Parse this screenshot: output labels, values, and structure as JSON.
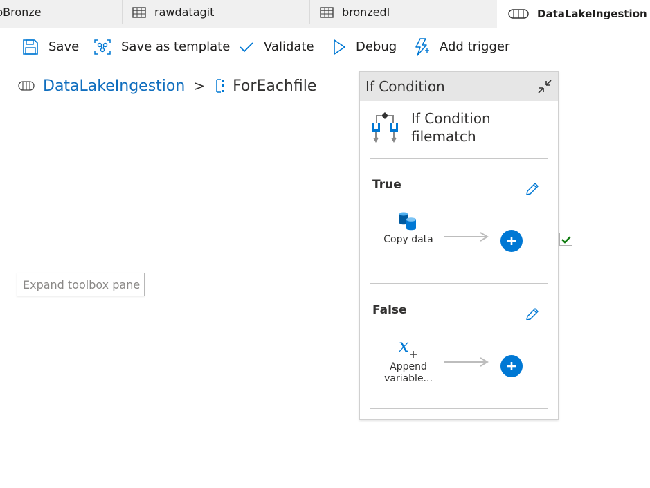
{
  "tabs": [
    {
      "label": "pBronze",
      "icon": "pipeline-icon"
    },
    {
      "label": "rawdatagit",
      "icon": "table-icon"
    },
    {
      "label": "bronzedl",
      "icon": "table-icon"
    },
    {
      "label": "DataLakeIngestion",
      "icon": "pipeline-icon",
      "active": true
    }
  ],
  "toolbar": {
    "save_label": "Save",
    "template_label": "Save as template",
    "validate_label": "Validate",
    "debug_label": "Debug",
    "trigger_label": "Add trigger"
  },
  "breadcrumb": {
    "pipeline": "DataLakeIngestion",
    "separator": ">",
    "current": "ForEachfile"
  },
  "expand_toolbox": "Expand toolbox pane",
  "if_condition": {
    "header": "If Condition",
    "activity_type": "If Condition",
    "activity_name": "filematch",
    "true_branch": {
      "label": "True",
      "activity_label": "Copy data"
    },
    "false_branch": {
      "label": "False",
      "activity_label_line1": "Append",
      "activity_label_line2": "variable..."
    }
  },
  "colors": {
    "accent": "#0078d4",
    "link": "#106ebe",
    "success": "#107c10"
  }
}
